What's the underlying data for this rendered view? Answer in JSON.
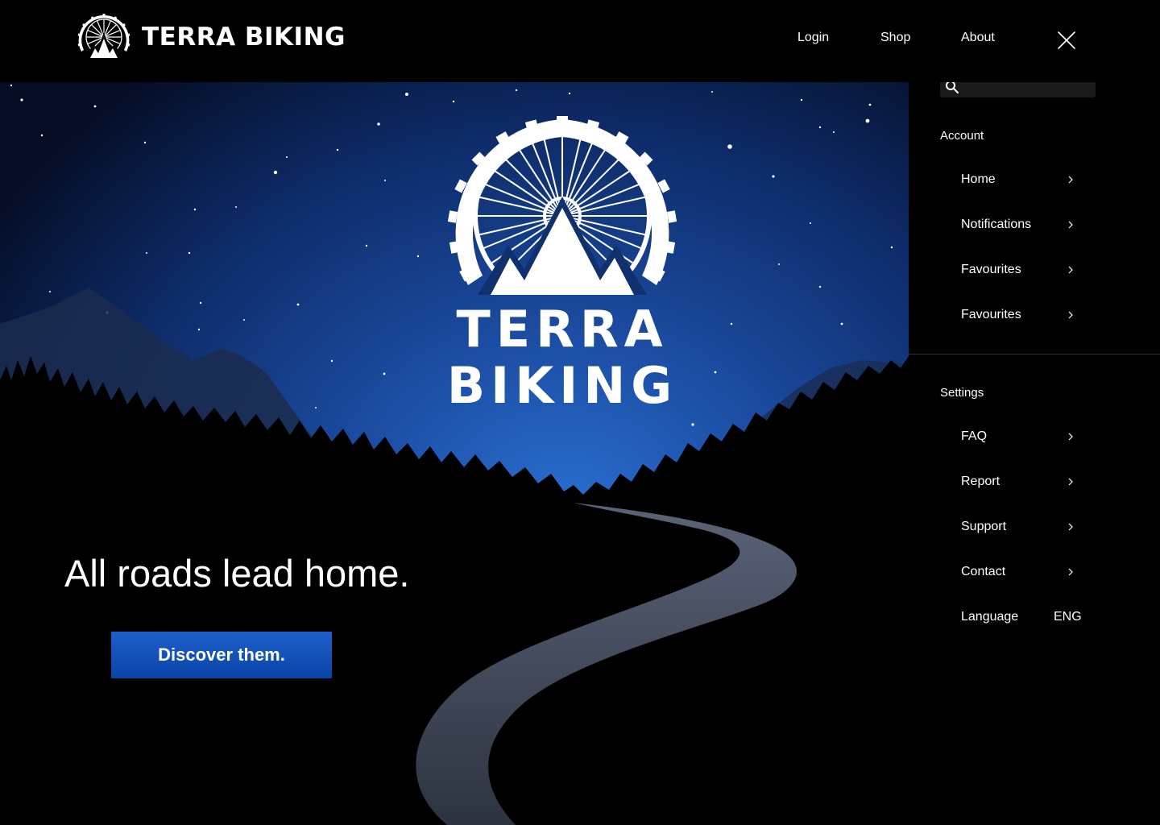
{
  "header": {
    "brand_name": "TERRA BIKING",
    "nav": [
      {
        "label": "Login"
      },
      {
        "label": "Shop"
      },
      {
        "label": "About"
      }
    ]
  },
  "hero": {
    "logo_text_line1": "TERRA",
    "logo_text_line2": "BIKING",
    "tagline": "All roads lead home.",
    "cta_label": "Discover them."
  },
  "menu": {
    "search": {
      "placeholder": "",
      "value": ""
    },
    "account": {
      "title": "Account",
      "items": [
        {
          "label": "Home"
        },
        {
          "label": "Notifications"
        },
        {
          "label": "Favourites"
        },
        {
          "label": "Favourites"
        }
      ]
    },
    "settings": {
      "title": "Settings",
      "items": [
        {
          "label": "FAQ"
        },
        {
          "label": "Report"
        },
        {
          "label": "Support"
        },
        {
          "label": "Contact"
        }
      ],
      "language": {
        "label": "Language",
        "value": "ENG"
      }
    }
  },
  "colors": {
    "background": "#000000",
    "sky_top": "#050d24",
    "sky_mid": "#0d2a66",
    "sky_glow": "#1f5fc2",
    "accent_button": "#0a44a8",
    "road": "#3a4250"
  },
  "icons": {
    "brand": "wheel-mountain-logo-icon",
    "close": "close-icon",
    "search": "search-icon",
    "chevron": "chevron-right-icon"
  }
}
